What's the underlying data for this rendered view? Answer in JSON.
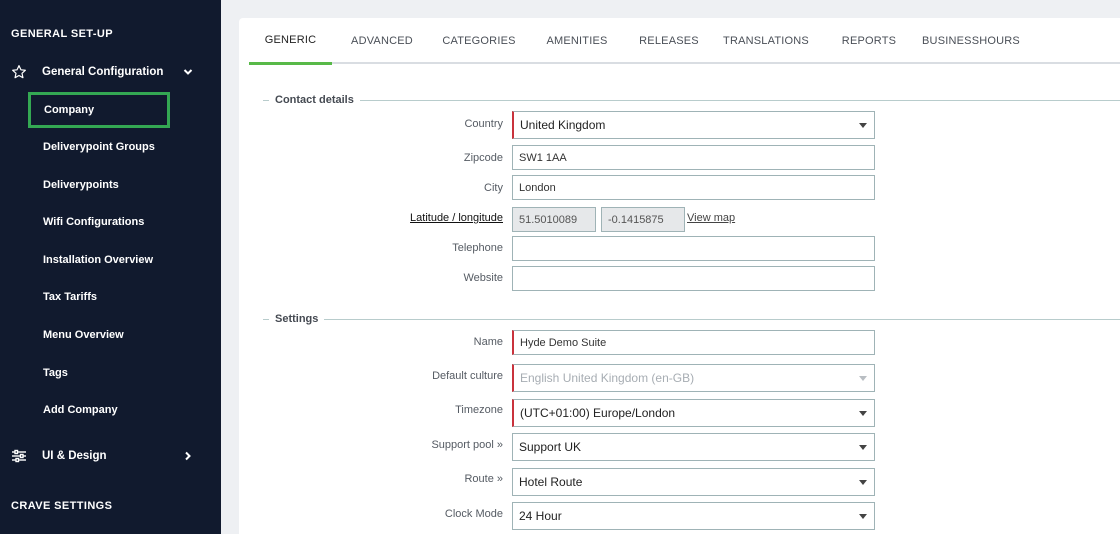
{
  "sidebar": {
    "section_general": "GENERAL SET-UP",
    "group_general_config": {
      "label": "General Configuration",
      "icon": "star-icon"
    },
    "items": [
      {
        "label": "Company",
        "active": true
      },
      {
        "label": "Deliverypoint Groups"
      },
      {
        "label": "Deliverypoints"
      },
      {
        "label": "Wifi Configurations"
      },
      {
        "label": "Installation Overview"
      },
      {
        "label": "Tax Tariffs"
      },
      {
        "label": "Menu Overview"
      },
      {
        "label": "Tags"
      },
      {
        "label": "Add Company"
      }
    ],
    "group_ui_design": {
      "label": "UI & Design",
      "icon": "sliders-icon"
    },
    "section_crave": "CRAVE SETTINGS"
  },
  "tabs": [
    "GENERIC",
    "ADVANCED",
    "CATEGORIES",
    "AMENITIES",
    "RELEASES",
    "TRANSLATIONS",
    "REPORTS",
    "BUSINESSHOURS"
  ],
  "active_tab": "GENERIC",
  "contact": {
    "legend": "Contact details",
    "country_label": "Country",
    "country_value": "United Kingdom",
    "zipcode_label": "Zipcode",
    "zipcode_value": "SW1 1AA",
    "city_label": "City",
    "city_value": "London",
    "latlng_label": "Latitude / longitude",
    "latitude": "51.5010089",
    "longitude": "-0.1415875",
    "view_map": "View map",
    "telephone_label": "Telephone",
    "telephone_value": "",
    "website_label": "Website",
    "website_value": ""
  },
  "settings": {
    "legend": "Settings",
    "name_label": "Name",
    "name_value": "Hyde Demo Suite",
    "culture_label": "Default culture",
    "culture_value": "English United Kingdom (en-GB)",
    "timezone_label": "Timezone",
    "timezone_value": "(UTC+01:00) Europe/London",
    "support_label": "Support pool »",
    "support_value": "Support UK",
    "route_label": "Route »",
    "route_value": "Hotel Route",
    "clock_label": "Clock Mode",
    "clock_value": "24 Hour"
  },
  "colors": {
    "sidebar_bg": "#111a2e",
    "accent_green": "#58b948",
    "required_red": "#c9323c"
  }
}
